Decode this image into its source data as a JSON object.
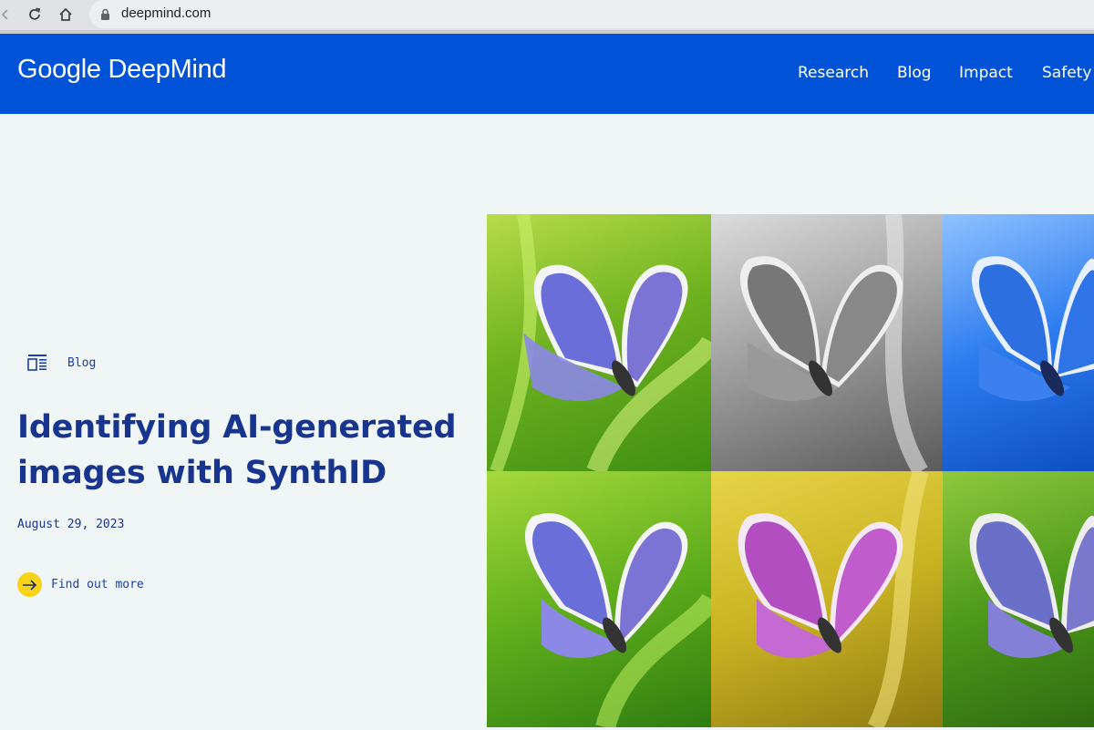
{
  "browser": {
    "url": "deepmind.com",
    "icons": [
      "back-icon",
      "reload-icon",
      "home-icon",
      "lock-icon"
    ]
  },
  "header": {
    "logo": "Google DeepMind",
    "nav": [
      "Research",
      "Blog",
      "Impact",
      "Safety"
    ],
    "color": "#0053d6"
  },
  "hero": {
    "tag": "Blog",
    "title_line1": "Identifying AI-generated",
    "title_line2": "images with SynthID",
    "date": "August 29, 2023",
    "cta": "Find out more"
  },
  "colors": {
    "accent_yellow": "#f7d417",
    "text_blue": "#17348f",
    "background": "#f0f5f5"
  },
  "image_grid": {
    "tiles": [
      "butterfly-green",
      "butterfly-grayscale",
      "butterfly-blue",
      "butterfly-green-2",
      "butterfly-yellow-purple",
      "butterfly-green-noise"
    ]
  }
}
